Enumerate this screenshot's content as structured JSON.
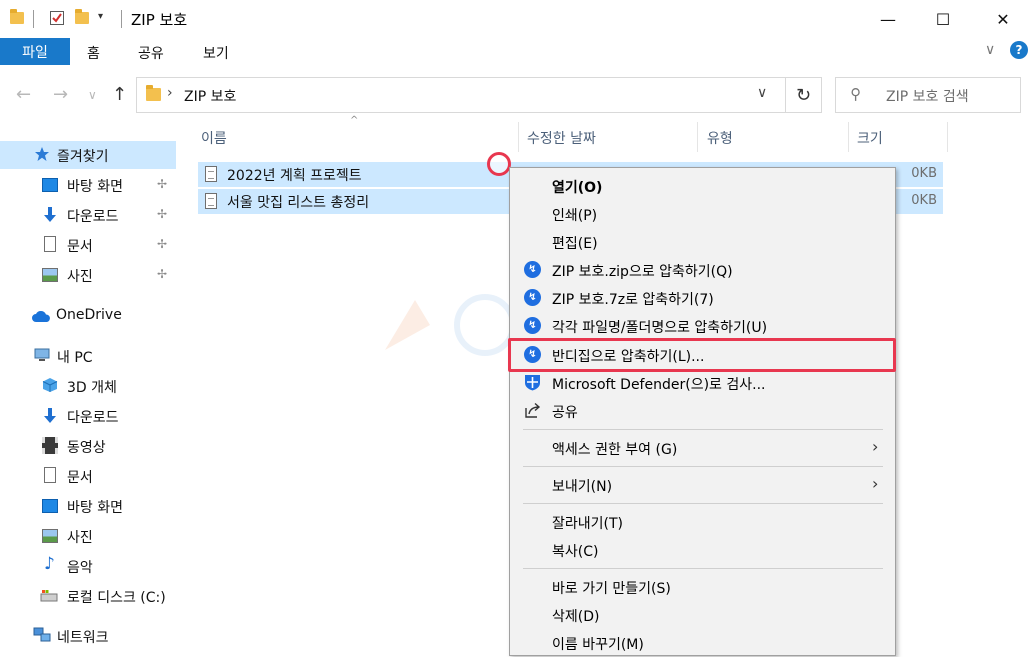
{
  "window": {
    "title": "ZIP 보호",
    "minimize_glyph": "—",
    "maximize_glyph": "☐",
    "close_glyph": "✕"
  },
  "ribbon": {
    "tabs": [
      "파일",
      "홈",
      "공유",
      "보기"
    ],
    "collapse_glyph": "∨",
    "help_glyph": "?"
  },
  "navigation": {
    "back_glyph": "←",
    "forward_glyph": "→",
    "recent_glyph": "∨",
    "up_glyph": "↑",
    "address_chevron": "›",
    "address_text": "ZIP 보호",
    "address_dropdown": "∨",
    "refresh_glyph": "↻",
    "search_placeholder": "ZIP 보호 검색",
    "search_glyph": "⚲"
  },
  "sidebar": {
    "items": [
      {
        "label": "즐겨찾기",
        "icon": "star-icon",
        "selected": true
      },
      {
        "label": "바탕 화면",
        "icon": "desktop-icon",
        "pinned": true
      },
      {
        "label": "다운로드",
        "icon": "download-icon",
        "pinned": true
      },
      {
        "label": "문서",
        "icon": "document-icon",
        "pinned": true
      },
      {
        "label": "사진",
        "icon": "picture-icon",
        "pinned": true
      },
      {
        "label": "OneDrive",
        "icon": "cloud-icon"
      },
      {
        "label": "내 PC",
        "icon": "computer-icon"
      },
      {
        "label": "3D 개체",
        "icon": "cube-icon"
      },
      {
        "label": "다운로드",
        "icon": "download-icon"
      },
      {
        "label": "동영상",
        "icon": "video-icon"
      },
      {
        "label": "문서",
        "icon": "document-icon"
      },
      {
        "label": "바탕 화면",
        "icon": "desktop-icon"
      },
      {
        "label": "사진",
        "icon": "picture-icon"
      },
      {
        "label": "음악",
        "icon": "music-icon"
      },
      {
        "label": "로컬 디스크 (C:)",
        "icon": "disk-icon"
      },
      {
        "label": "네트워크",
        "icon": "network-icon"
      }
    ],
    "pin_glyph": "📌"
  },
  "file_list": {
    "columns": [
      "이름",
      "수정한 날짜",
      "유형",
      "크기"
    ],
    "sort_glyph": "^",
    "files": [
      {
        "name": "2022년 계획 프로젝트",
        "size": "0KB"
      },
      {
        "name": "서울 맛집 리스트 총정리",
        "size": "0KB"
      }
    ]
  },
  "context_menu": {
    "items": [
      {
        "label": "열기(O)",
        "bold": true
      },
      {
        "label": "인쇄(P)"
      },
      {
        "label": "편집(E)"
      },
      {
        "label": "ZIP 보호.zip으로 압축하기(Q)",
        "icon": "bandizip-icon"
      },
      {
        "label": "ZIP 보호.7z로 압축하기(7)",
        "icon": "bandizip-icon"
      },
      {
        "label": "각각 파일명/폴더명으로 압축하기(U)",
        "icon": "bandizip-icon"
      },
      {
        "label": "반디집으로 압축하기(L)...",
        "icon": "bandizip-icon",
        "highlighted": true
      },
      {
        "label": "Microsoft Defender(으)로 검사...",
        "icon": "defender-icon"
      },
      {
        "label": "공유",
        "icon": "share-icon"
      },
      {
        "label": "액세스 권한 부여 (G)",
        "submenu": true
      },
      {
        "label": "보내기(N)",
        "submenu": true
      },
      {
        "label": "잘라내기(T)"
      },
      {
        "label": "복사(C)"
      },
      {
        "label": "바로 가기 만들기(S)"
      },
      {
        "label": "삭제(D)"
      },
      {
        "label": "이름 바꾸기(M)"
      }
    ],
    "submenu_glyph": "›"
  },
  "colors": {
    "accent": "#1979ca",
    "selection": "#cce8ff",
    "highlight_ring": "#e8374f"
  }
}
